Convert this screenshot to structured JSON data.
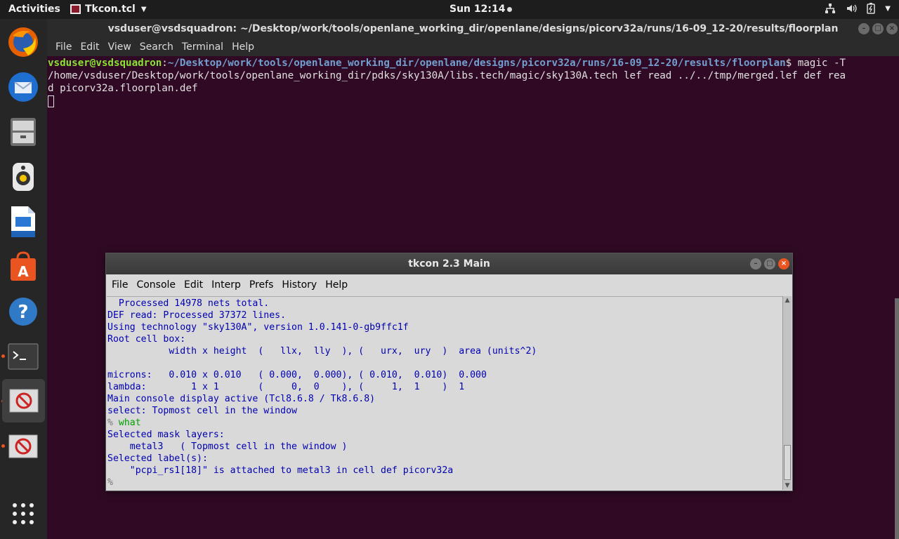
{
  "topbar": {
    "activities": "Activities",
    "app_name": "Tkcon.tcl",
    "clock": "Sun 12:14"
  },
  "terminal": {
    "title": "vsduser@vsdsquadron: ~/Desktop/work/tools/openlane_working_dir/openlane/designs/picorv32a/runs/16-09_12-20/results/floorplan",
    "menu": [
      "File",
      "Edit",
      "View",
      "Search",
      "Terminal",
      "Help"
    ],
    "prompt_user": "vsduser@vsdsquadron",
    "prompt_path": "~/Desktop/work/tools/openlane_working_dir/openlane/designs/picorv32a/runs/16-09_12-20/results/floorplan",
    "command_line1": "$ magic -T",
    "command_line2": "/home/vsduser/Desktop/work/tools/openlane_working_dir/pdks/sky130A/libs.tech/magic/sky130A.tech lef read ../../tmp/merged.lef def rea",
    "command_line3": "d picorv32a.floorplan.def"
  },
  "tkcon": {
    "title": "tkcon 2.3 Main",
    "menu": [
      "File",
      "Console",
      "Edit",
      "Interp",
      "Prefs",
      "History",
      "Help"
    ],
    "lines": [
      "  Processed 14978 nets total.",
      "DEF read: Processed 37372 lines.",
      "Using technology \"sky130A\", version 1.0.141-0-gb9ffc1f",
      "Root cell box:",
      "           width x height  (   llx,  lly  ), (   urx,  ury  )  area (units^2)",
      "",
      "microns:   0.010 x 0.010   ( 0.000,  0.000), ( 0.010,  0.010)  0.000",
      "lambda:        1 x 1       (     0,  0    ), (     1,  1    )  1",
      "Main console display active (Tcl8.6.8 / Tk8.6.8)",
      "select: Topmost cell in the window"
    ],
    "prompt": "%",
    "command": "what",
    "lines_after": [
      "Selected mask layers:",
      "    metal3   ( Topmost cell in the window )",
      "Selected label(s):",
      "    \"pcpi_rs1[18]\" is attached to metal3 in cell def picorv32a"
    ],
    "final_prompt": "%"
  }
}
